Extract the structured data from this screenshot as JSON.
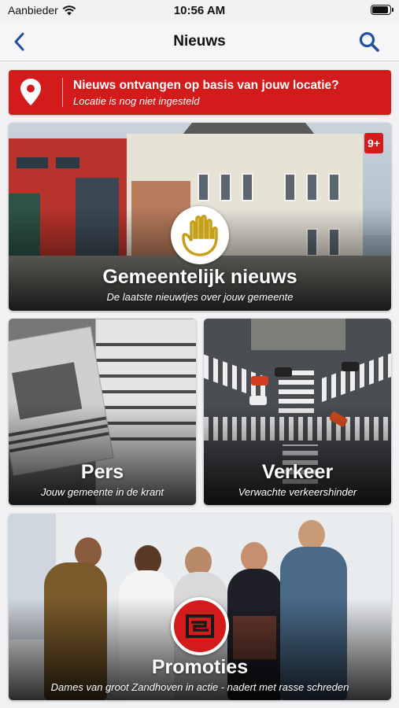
{
  "status": {
    "carrier": "Aanbieder",
    "time": "10:56 AM",
    "battery_level": 0.9
  },
  "nav": {
    "title": "Nieuws",
    "back_icon": "chevron-left-icon",
    "search_icon": "search-icon",
    "accent": "#1e4fa0"
  },
  "location_banner": {
    "title": "Nieuws ontvangen op basis van jouw locatie?",
    "subtitle": "Locatie is nog niet ingesteld",
    "icon": "location-pin-icon",
    "color": "#d31b1b"
  },
  "tiles": [
    {
      "title": "Gemeentelijk nieuws",
      "subtitle": "De laatste nieuwtjes over jouw gemeente",
      "badge": "9+"
    },
    {
      "title": "Pers",
      "subtitle": "Jouw gemeente in de krant"
    },
    {
      "title": "Verkeer",
      "subtitle": "Verwachte verkeershinder"
    },
    {
      "title": "Promoties",
      "subtitle": "Dames van groot Zandhoven in actie - nadert met rasse schreden"
    }
  ]
}
